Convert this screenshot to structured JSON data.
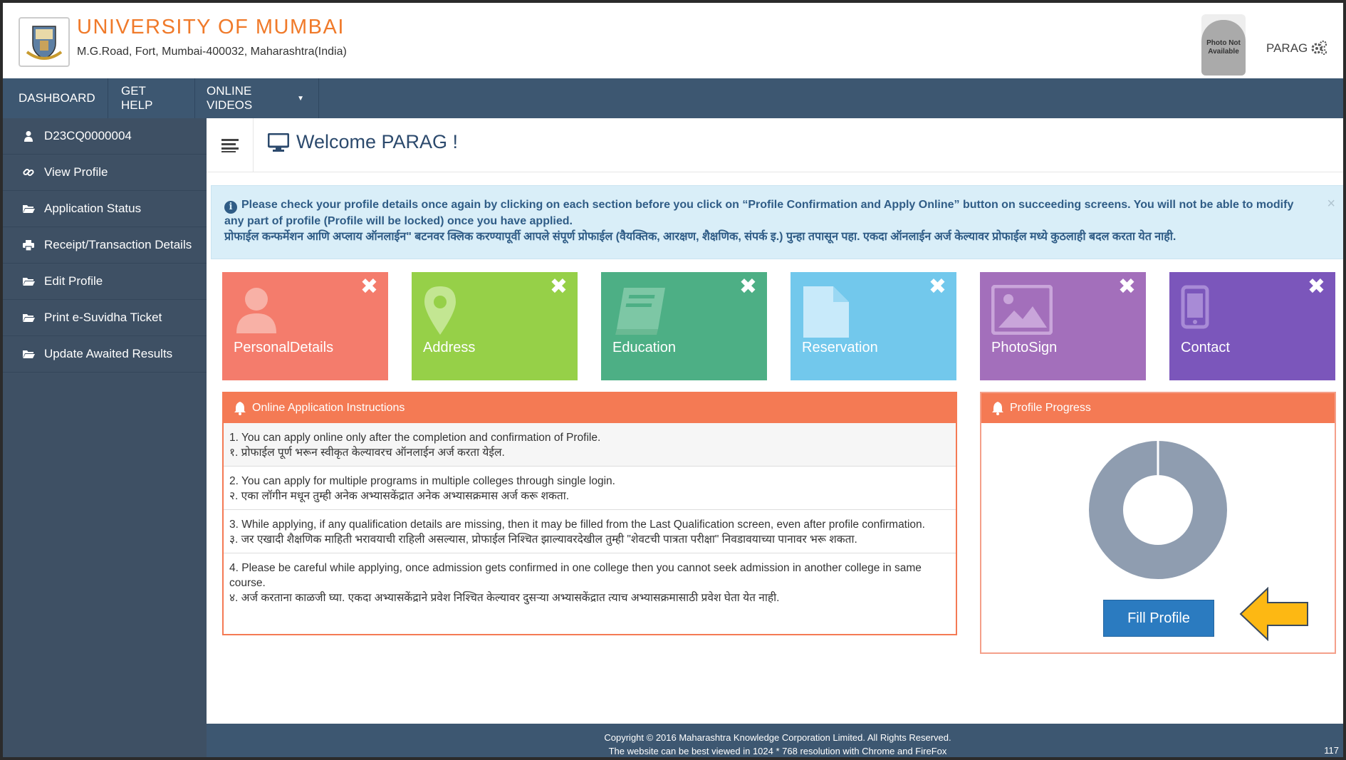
{
  "header": {
    "university_name": "UNIVERSITY OF MUMBAI",
    "address": "M.G.Road, Fort, Mumbai-400032, Maharashtra(India)",
    "avatar_text": "Photo Not Available",
    "user_name": "PARAG"
  },
  "topnav": {
    "items": [
      "DASHBOARD",
      "GET HELP",
      "ONLINE VIDEOS"
    ]
  },
  "sidebar": {
    "items": [
      {
        "label": "D23CQ0000004",
        "icon": "user-icon"
      },
      {
        "label": "View Profile",
        "icon": "link-icon"
      },
      {
        "label": "Application Status",
        "icon": "folder-icon"
      },
      {
        "label": "Receipt/Transaction Details",
        "icon": "print-icon"
      },
      {
        "label": "Edit Profile",
        "icon": "folder-icon"
      },
      {
        "label": "Print e-Suvidha Ticket",
        "icon": "folder-icon"
      },
      {
        "label": "Update Awaited Results",
        "icon": "folder-icon"
      }
    ]
  },
  "main": {
    "welcome": "Welcome PARAG !",
    "alert_en": "Please check your profile details once again by clicking on each section before you click on “Profile Confirmation and Apply Online” button on succeeding screens. You will not be able to modify any part of profile (Profile will be locked) once you have applied.",
    "alert_mr": "प्रोफाईल कन्फर्मेशन आणि अप्लाय ऑनलाईन\" बटनवर क्लिक करण्यापूर्वी आपले संपूर्ण प्रोफाईल (वैयक्तिक, आरक्षण, शैक्षणिक, संपर्क इ.) पुन्हा तपासून पहा. एकदा ऑनलाईन अर्ज केल्यावर प्रोफाईल मध्ये कुठलाही बदल करता येत नाही.",
    "alert_close": "×",
    "tiles": [
      {
        "label": "PersonalDetails",
        "color": "#f47c6c",
        "icon": "person-icon"
      },
      {
        "label": "Address",
        "color": "#96d048",
        "icon": "map-pin-icon"
      },
      {
        "label": "Education",
        "color": "#4daf85",
        "icon": "book-icon"
      },
      {
        "label": "Reservation",
        "color": "#72c8ec",
        "icon": "document-icon"
      },
      {
        "label": "PhotoSign",
        "color": "#a36fbb",
        "icon": "image-icon"
      },
      {
        "label": "Contact",
        "color": "#7b56bb",
        "icon": "phone-icon"
      }
    ],
    "tile_close": "✖",
    "instructions": {
      "title": "Online Application Instructions",
      "items": [
        {
          "en": "1. You can apply online only after the completion and confirmation of Profile.",
          "mr": "१. प्रोफाईल पूर्ण भरून स्वीकृत केल्यावरच ऑनलाईन अर्ज करता येईल."
        },
        {
          "en": "2. You can apply for multiple programs in multiple colleges through single login.",
          "mr": "२. एका लॉगीन मधून तुम्ही अनेक अभ्यासकेंद्रात अनेक अभ्यासक्रमास अर्ज करू शकता."
        },
        {
          "en": "3. While applying, if any qualification details are missing, then it may be filled from the Last Qualification screen, even after profile confirmation.",
          "mr": "३. जर एखादी शैक्षणिक माहिती भरावयाची राहिली असल्यास, प्रोफाईल निश्चित झाल्यावरदेखील तुम्ही \"शेवटची पात्रता परीक्षा\" निवडावयाच्या पानावर भरू शकता."
        },
        {
          "en": "4. Please be careful while applying, once admission gets confirmed in one college then you cannot seek admission in another college in same course.",
          "mr": "४. अर्ज करताना काळजी घ्या. एकदा अभ्यासकेंद्राने प्रवेश निश्चित केल्यावर दुसऱ्या अभ्यासकेंद्रात त्याच अभ्यासक्रमासाठी प्रवेश घेता येत नाही."
        }
      ]
    },
    "progress": {
      "title": "Profile Progress",
      "ring_color": "#8f9db0",
      "fill_button": "Fill Profile",
      "arrow_color": "#fdb813"
    }
  },
  "footer": {
    "line1": "Copyright © 2016 Maharashtra Knowledge Corporation Limited. All Rights Reserved.",
    "line2": "The website can be best viewed in 1024 * 768 resolution with Chrome and FireFox",
    "page_number": "117"
  }
}
